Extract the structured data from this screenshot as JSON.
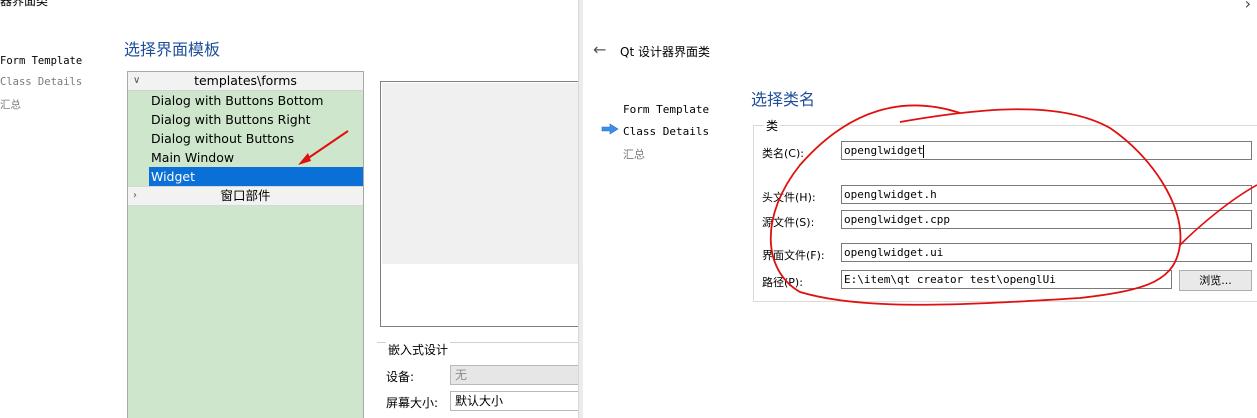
{
  "left_window": {
    "title_fragment": "器界面类",
    "steps": [
      "Form Template",
      "Class Details",
      "汇总"
    ],
    "heading": "选择界面模板",
    "templates_header": "templates\\forms",
    "templates": [
      "Dialog with Buttons Bottom",
      "Dialog with Buttons Right",
      "Dialog without Buttons",
      "Main Window",
      "Widget"
    ],
    "selected_template": "Widget",
    "widgets_header": "窗口部件",
    "embed": {
      "title": "嵌入式设计",
      "device_label": "设备:",
      "device_value": "无",
      "screen_label": "屏幕大小:",
      "screen_value": "默认大小"
    }
  },
  "right_window": {
    "title": "Qt 设计器界面类",
    "steps": [
      "Form Template",
      "Class Details",
      "汇总"
    ],
    "heading": "选择类名",
    "group_title": "类",
    "fields": {
      "class_name": {
        "label": "类名(C):",
        "value": "openglwidget"
      },
      "header_file": {
        "label": "头文件(H):",
        "value": "openglwidget.h"
      },
      "source_file": {
        "label": "源文件(S):",
        "value": "openglwidget.cpp"
      },
      "form_file": {
        "label": "界面文件(F):",
        "value": "openglwidget.ui"
      },
      "path": {
        "label": "路径(P):",
        "value": "E:\\item\\qt creator test\\openglUi"
      }
    },
    "browse_label": "浏览...",
    "back_icon": "arrow-left-icon",
    "close_icon": "close-icon"
  },
  "colors": {
    "heading": "#1f4e9b",
    "list_bg": "#cde6cc",
    "selection": "#0a6fd6",
    "annotation": "#e01010"
  }
}
